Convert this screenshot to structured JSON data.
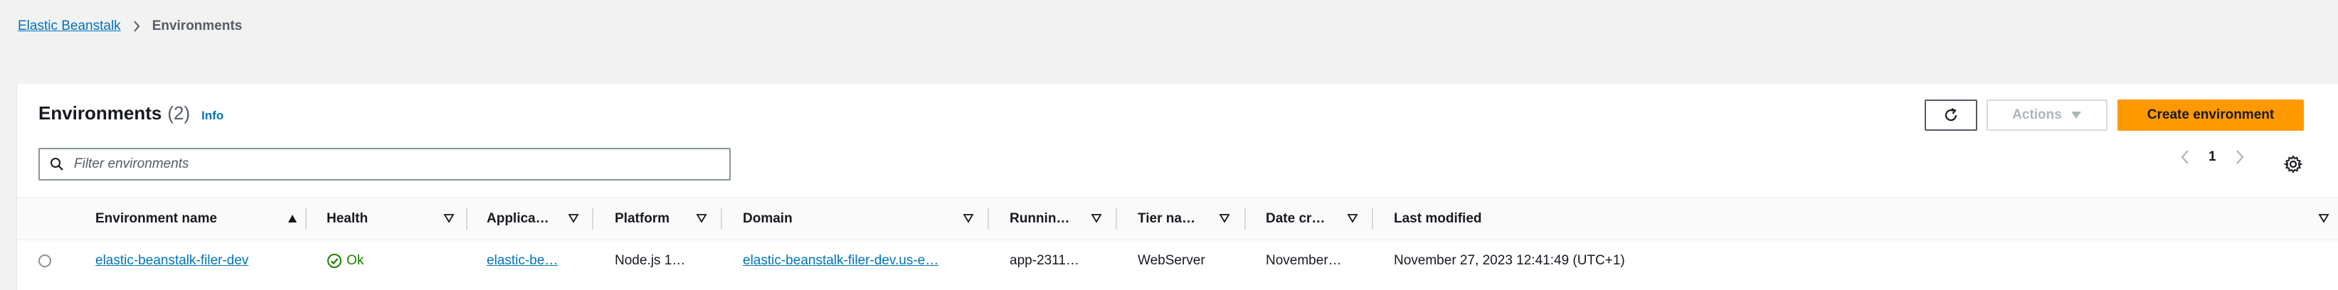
{
  "breadcrumb": {
    "root": "Elastic Beanstalk",
    "current": "Environments"
  },
  "panel": {
    "title": "Environments",
    "count": "(2)",
    "info": "Info"
  },
  "toolbar": {
    "actions_label": "Actions",
    "create_label": "Create environment"
  },
  "filter": {
    "placeholder": "Filter environments"
  },
  "pagination": {
    "current_page": "1"
  },
  "table": {
    "columns": [
      "Environment name",
      "Health",
      "Applica…",
      "Platform",
      "Domain",
      "Runnin…",
      "Tier na…",
      "Date cr…",
      "Last modified"
    ],
    "rows": [
      {
        "environment_name": "elastic-beanstalk-filer-dev",
        "health": "Ok",
        "application": "elastic-be…",
        "platform": "Node.js 1…",
        "domain": "elastic-beanstalk-filer-dev.us-e…",
        "running_version": "app-2311…",
        "tier_name": "WebServer",
        "date_created": "November…",
        "last_modified": "November 27, 2023 12:41:49 (UTC+1)"
      }
    ]
  },
  "colors": {
    "link": "#0073bb",
    "primary": "#ff9900",
    "success": "#1d8102",
    "background": "#f2f2f2"
  }
}
